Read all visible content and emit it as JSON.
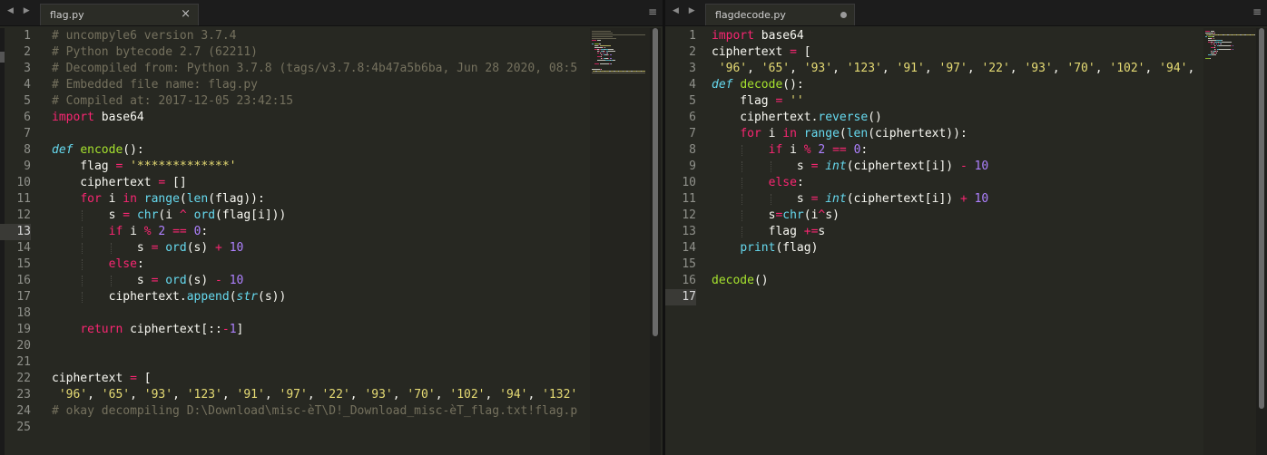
{
  "colors": {
    "background": "#272822",
    "comment": "#75715e",
    "keyword": "#f92672",
    "function": "#a6e22e",
    "builtin": "#66d9ef",
    "string": "#e6db74",
    "number": "#ae81ff",
    "text": "#f8f8f2"
  },
  "nav_arrows": "◀ ▶",
  "menu_glyph": "≡",
  "left_pane": {
    "tab": {
      "filename": "flag.py",
      "close_glyph": "×"
    },
    "current_line": 13,
    "lines": [
      [
        {
          "t": "# uncompyle6 version 3.7.4",
          "c": "com"
        }
      ],
      [
        {
          "t": "# Python bytecode 2.7 (62211)",
          "c": "com"
        }
      ],
      [
        {
          "t": "# Decompiled from: Python 3.7.8 (tags/v3.7.8:4b47a5b6ba, Jun 28 2020, 08:5",
          "c": "com"
        }
      ],
      [
        {
          "t": "# Embedded file name: flag.py",
          "c": "com"
        }
      ],
      [
        {
          "t": "# Compiled at: 2017-12-05 23:42:15",
          "c": "com"
        }
      ],
      [
        {
          "t": "import",
          "c": "kw"
        },
        {
          "t": " base64",
          "c": "tx"
        }
      ],
      [],
      [
        {
          "t": "def",
          "c": "def"
        },
        {
          "t": " ",
          "c": "tx"
        },
        {
          "t": "encode",
          "c": "fn"
        },
        {
          "t": "():",
          "c": "tx"
        }
      ],
      [
        {
          "t": "    flag ",
          "c": "tx"
        },
        {
          "t": "=",
          "c": "op"
        },
        {
          "t": " ",
          "c": "tx"
        },
        {
          "t": "'*************'",
          "c": "str"
        }
      ],
      [
        {
          "t": "    ciphertext ",
          "c": "tx"
        },
        {
          "t": "=",
          "c": "op"
        },
        {
          "t": " []",
          "c": "tx"
        }
      ],
      [
        {
          "t": "    ",
          "c": "tx"
        },
        {
          "t": "for",
          "c": "kw"
        },
        {
          "t": " i ",
          "c": "tx"
        },
        {
          "t": "in",
          "c": "kw"
        },
        {
          "t": " ",
          "c": "tx"
        },
        {
          "t": "range",
          "c": "bi"
        },
        {
          "t": "(",
          "c": "tx"
        },
        {
          "t": "len",
          "c": "bi"
        },
        {
          "t": "(flag)):",
          "c": "tx"
        }
      ],
      [
        {
          "t": "        s ",
          "c": "tx"
        },
        {
          "t": "=",
          "c": "op"
        },
        {
          "t": " ",
          "c": "tx"
        },
        {
          "t": "chr",
          "c": "bi"
        },
        {
          "t": "(i ",
          "c": "tx"
        },
        {
          "t": "^",
          "c": "op"
        },
        {
          "t": " ",
          "c": "tx"
        },
        {
          "t": "ord",
          "c": "bi"
        },
        {
          "t": "(flag[i]))",
          "c": "tx"
        }
      ],
      [
        {
          "t": "        ",
          "c": "tx"
        },
        {
          "t": "if",
          "c": "kw"
        },
        {
          "t": " i ",
          "c": "tx"
        },
        {
          "t": "%",
          "c": "op"
        },
        {
          "t": " ",
          "c": "tx"
        },
        {
          "t": "2",
          "c": "num"
        },
        {
          "t": " ",
          "c": "tx"
        },
        {
          "t": "==",
          "c": "op"
        },
        {
          "t": " ",
          "c": "tx"
        },
        {
          "t": "0",
          "c": "num"
        },
        {
          "t": ":",
          "c": "tx"
        }
      ],
      [
        {
          "t": "            s ",
          "c": "tx"
        },
        {
          "t": "=",
          "c": "op"
        },
        {
          "t": " ",
          "c": "tx"
        },
        {
          "t": "ord",
          "c": "bi"
        },
        {
          "t": "(s) ",
          "c": "tx"
        },
        {
          "t": "+",
          "c": "op"
        },
        {
          "t": " ",
          "c": "tx"
        },
        {
          "t": "10",
          "c": "num"
        }
      ],
      [
        {
          "t": "        ",
          "c": "tx"
        },
        {
          "t": "else",
          "c": "kw"
        },
        {
          "t": ":",
          "c": "tx"
        }
      ],
      [
        {
          "t": "            s ",
          "c": "tx"
        },
        {
          "t": "=",
          "c": "op"
        },
        {
          "t": " ",
          "c": "tx"
        },
        {
          "t": "ord",
          "c": "bi"
        },
        {
          "t": "(s) ",
          "c": "tx"
        },
        {
          "t": "-",
          "c": "op"
        },
        {
          "t": " ",
          "c": "tx"
        },
        {
          "t": "10",
          "c": "num"
        }
      ],
      [
        {
          "t": "        ciphertext.",
          "c": "tx"
        },
        {
          "t": "append",
          "c": "bi"
        },
        {
          "t": "(",
          "c": "tx"
        },
        {
          "t": "str",
          "c": "bii"
        },
        {
          "t": "(s))",
          "c": "tx"
        }
      ],
      [],
      [
        {
          "t": "    ",
          "c": "tx"
        },
        {
          "t": "return",
          "c": "kw"
        },
        {
          "t": " ciphertext[::",
          "c": "tx"
        },
        {
          "t": "-",
          "c": "op"
        },
        {
          "t": "1",
          "c": "num"
        },
        {
          "t": "]",
          "c": "tx"
        }
      ],
      [],
      [],
      [
        {
          "t": "ciphertext ",
          "c": "tx"
        },
        {
          "t": "=",
          "c": "op"
        },
        {
          "t": " [",
          "c": "tx"
        }
      ],
      [
        {
          "t": " ",
          "c": "tx"
        },
        {
          "t": "'96'",
          "c": "str"
        },
        {
          "t": ", ",
          "c": "tx"
        },
        {
          "t": "'65'",
          "c": "str"
        },
        {
          "t": ", ",
          "c": "tx"
        },
        {
          "t": "'93'",
          "c": "str"
        },
        {
          "t": ", ",
          "c": "tx"
        },
        {
          "t": "'123'",
          "c": "str"
        },
        {
          "t": ", ",
          "c": "tx"
        },
        {
          "t": "'91'",
          "c": "str"
        },
        {
          "t": ", ",
          "c": "tx"
        },
        {
          "t": "'97'",
          "c": "str"
        },
        {
          "t": ", ",
          "c": "tx"
        },
        {
          "t": "'22'",
          "c": "str"
        },
        {
          "t": ", ",
          "c": "tx"
        },
        {
          "t": "'93'",
          "c": "str"
        },
        {
          "t": ", ",
          "c": "tx"
        },
        {
          "t": "'70'",
          "c": "str"
        },
        {
          "t": ", ",
          "c": "tx"
        },
        {
          "t": "'102'",
          "c": "str"
        },
        {
          "t": ", ",
          "c": "tx"
        },
        {
          "t": "'94'",
          "c": "str"
        },
        {
          "t": ", ",
          "c": "tx"
        },
        {
          "t": "'132'",
          "c": "str"
        }
      ],
      [
        {
          "t": "# okay decompiling D:\\Download\\misc-èT\\D!_Download_misc-èT_flag.txt!flag.p",
          "c": "com"
        }
      ],
      []
    ]
  },
  "right_pane": {
    "tab": {
      "filename": "flagdecode.py",
      "modified": true
    },
    "current_line": 17,
    "lines": [
      [
        {
          "t": "import",
          "c": "kw"
        },
        {
          "t": " base64",
          "c": "tx"
        }
      ],
      [
        {
          "t": "ciphertext ",
          "c": "tx"
        },
        {
          "t": "=",
          "c": "op"
        },
        {
          "t": " [",
          "c": "tx"
        }
      ],
      [
        {
          "t": " ",
          "c": "tx"
        },
        {
          "t": "'96'",
          "c": "str"
        },
        {
          "t": ", ",
          "c": "tx"
        },
        {
          "t": "'65'",
          "c": "str"
        },
        {
          "t": ", ",
          "c": "tx"
        },
        {
          "t": "'93'",
          "c": "str"
        },
        {
          "t": ", ",
          "c": "tx"
        },
        {
          "t": "'123'",
          "c": "str"
        },
        {
          "t": ", ",
          "c": "tx"
        },
        {
          "t": "'91'",
          "c": "str"
        },
        {
          "t": ", ",
          "c": "tx"
        },
        {
          "t": "'97'",
          "c": "str"
        },
        {
          "t": ", ",
          "c": "tx"
        },
        {
          "t": "'22'",
          "c": "str"
        },
        {
          "t": ", ",
          "c": "tx"
        },
        {
          "t": "'93'",
          "c": "str"
        },
        {
          "t": ", ",
          "c": "tx"
        },
        {
          "t": "'70'",
          "c": "str"
        },
        {
          "t": ", ",
          "c": "tx"
        },
        {
          "t": "'102'",
          "c": "str"
        },
        {
          "t": ", ",
          "c": "tx"
        },
        {
          "t": "'94'",
          "c": "str"
        },
        {
          "t": ",",
          "c": "tx"
        }
      ],
      [
        {
          "t": "def",
          "c": "def"
        },
        {
          "t": " ",
          "c": "tx"
        },
        {
          "t": "decode",
          "c": "fn"
        },
        {
          "t": "():",
          "c": "tx"
        }
      ],
      [
        {
          "t": "    flag ",
          "c": "tx"
        },
        {
          "t": "=",
          "c": "op"
        },
        {
          "t": " ",
          "c": "tx"
        },
        {
          "t": "''",
          "c": "str"
        }
      ],
      [
        {
          "t": "    ciphertext.",
          "c": "tx"
        },
        {
          "t": "reverse",
          "c": "bi"
        },
        {
          "t": "()",
          "c": "tx"
        }
      ],
      [
        {
          "t": "    ",
          "c": "tx"
        },
        {
          "t": "for",
          "c": "kw"
        },
        {
          "t": " i ",
          "c": "tx"
        },
        {
          "t": "in",
          "c": "kw"
        },
        {
          "t": " ",
          "c": "tx"
        },
        {
          "t": "range",
          "c": "bi"
        },
        {
          "t": "(",
          "c": "tx"
        },
        {
          "t": "len",
          "c": "bi"
        },
        {
          "t": "(ciphertext)):",
          "c": "tx"
        }
      ],
      [
        {
          "t": "        ",
          "c": "tx"
        },
        {
          "t": "if",
          "c": "kw"
        },
        {
          "t": " i ",
          "c": "tx"
        },
        {
          "t": "%",
          "c": "op"
        },
        {
          "t": " ",
          "c": "tx"
        },
        {
          "t": "2",
          "c": "num"
        },
        {
          "t": " ",
          "c": "tx"
        },
        {
          "t": "==",
          "c": "op"
        },
        {
          "t": " ",
          "c": "tx"
        },
        {
          "t": "0",
          "c": "num"
        },
        {
          "t": ":",
          "c": "tx"
        }
      ],
      [
        {
          "t": "            s ",
          "c": "tx"
        },
        {
          "t": "=",
          "c": "op"
        },
        {
          "t": " ",
          "c": "tx"
        },
        {
          "t": "int",
          "c": "bii"
        },
        {
          "t": "(ciphertext[i]) ",
          "c": "tx"
        },
        {
          "t": "-",
          "c": "op"
        },
        {
          "t": " ",
          "c": "tx"
        },
        {
          "t": "10",
          "c": "num"
        }
      ],
      [
        {
          "t": "        ",
          "c": "tx"
        },
        {
          "t": "else",
          "c": "kw"
        },
        {
          "t": ":",
          "c": "tx"
        }
      ],
      [
        {
          "t": "            s ",
          "c": "tx"
        },
        {
          "t": "=",
          "c": "op"
        },
        {
          "t": " ",
          "c": "tx"
        },
        {
          "t": "int",
          "c": "bii"
        },
        {
          "t": "(ciphertext[i]) ",
          "c": "tx"
        },
        {
          "t": "+",
          "c": "op"
        },
        {
          "t": " ",
          "c": "tx"
        },
        {
          "t": "10",
          "c": "num"
        }
      ],
      [
        {
          "t": "        s",
          "c": "tx"
        },
        {
          "t": "=",
          "c": "op"
        },
        {
          "t": "chr",
          "c": "bi"
        },
        {
          "t": "(i",
          "c": "tx"
        },
        {
          "t": "^",
          "c": "op"
        },
        {
          "t": "s)",
          "c": "tx"
        }
      ],
      [
        {
          "t": "        flag ",
          "c": "tx"
        },
        {
          "t": "+=",
          "c": "op"
        },
        {
          "t": "s",
          "c": "tx"
        }
      ],
      [
        {
          "t": "    ",
          "c": "tx"
        },
        {
          "t": "print",
          "c": "bi"
        },
        {
          "t": "(flag)",
          "c": "tx"
        }
      ],
      [],
      [
        {
          "t": "decode",
          "c": "fn"
        },
        {
          "t": "()",
          "c": "tx"
        }
      ],
      []
    ]
  }
}
